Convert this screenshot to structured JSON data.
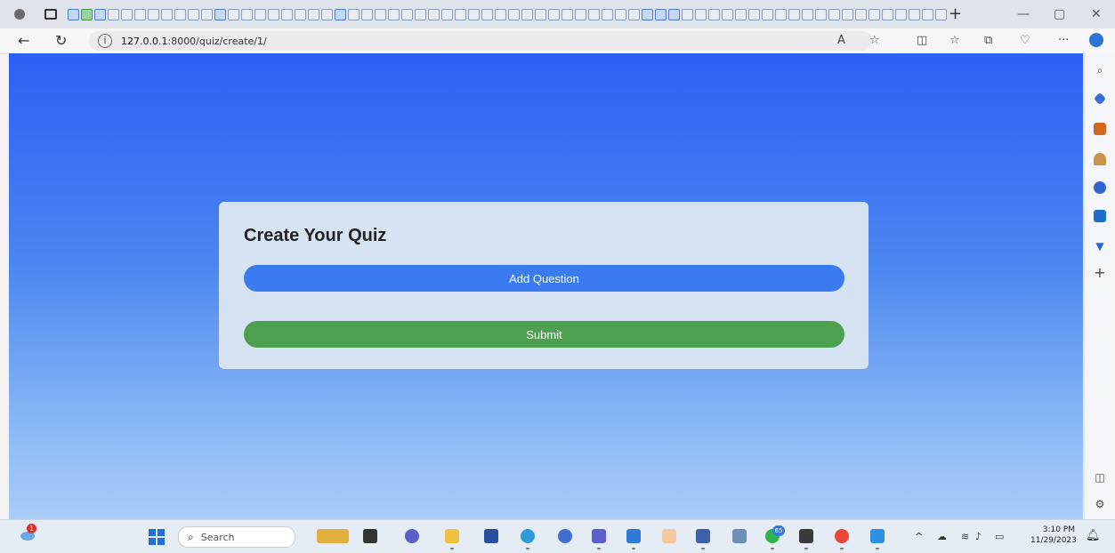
{
  "browser": {
    "address": {
      "host": "127.0.0.1",
      "path": ":8000/quiz/create/1/"
    }
  },
  "page": {
    "title": "Create Your Quiz",
    "add_question_label": "Add Question",
    "submit_label": "Submit"
  },
  "colors": {
    "add_button": "#3b7bf0",
    "submit_button": "#4da04f",
    "card": "#d5e3f3"
  },
  "taskbar": {
    "search_placeholder": "Search",
    "notification_badge": "1",
    "app_badge": "65",
    "time": "3:10 PM",
    "date": "11/29/2023"
  }
}
